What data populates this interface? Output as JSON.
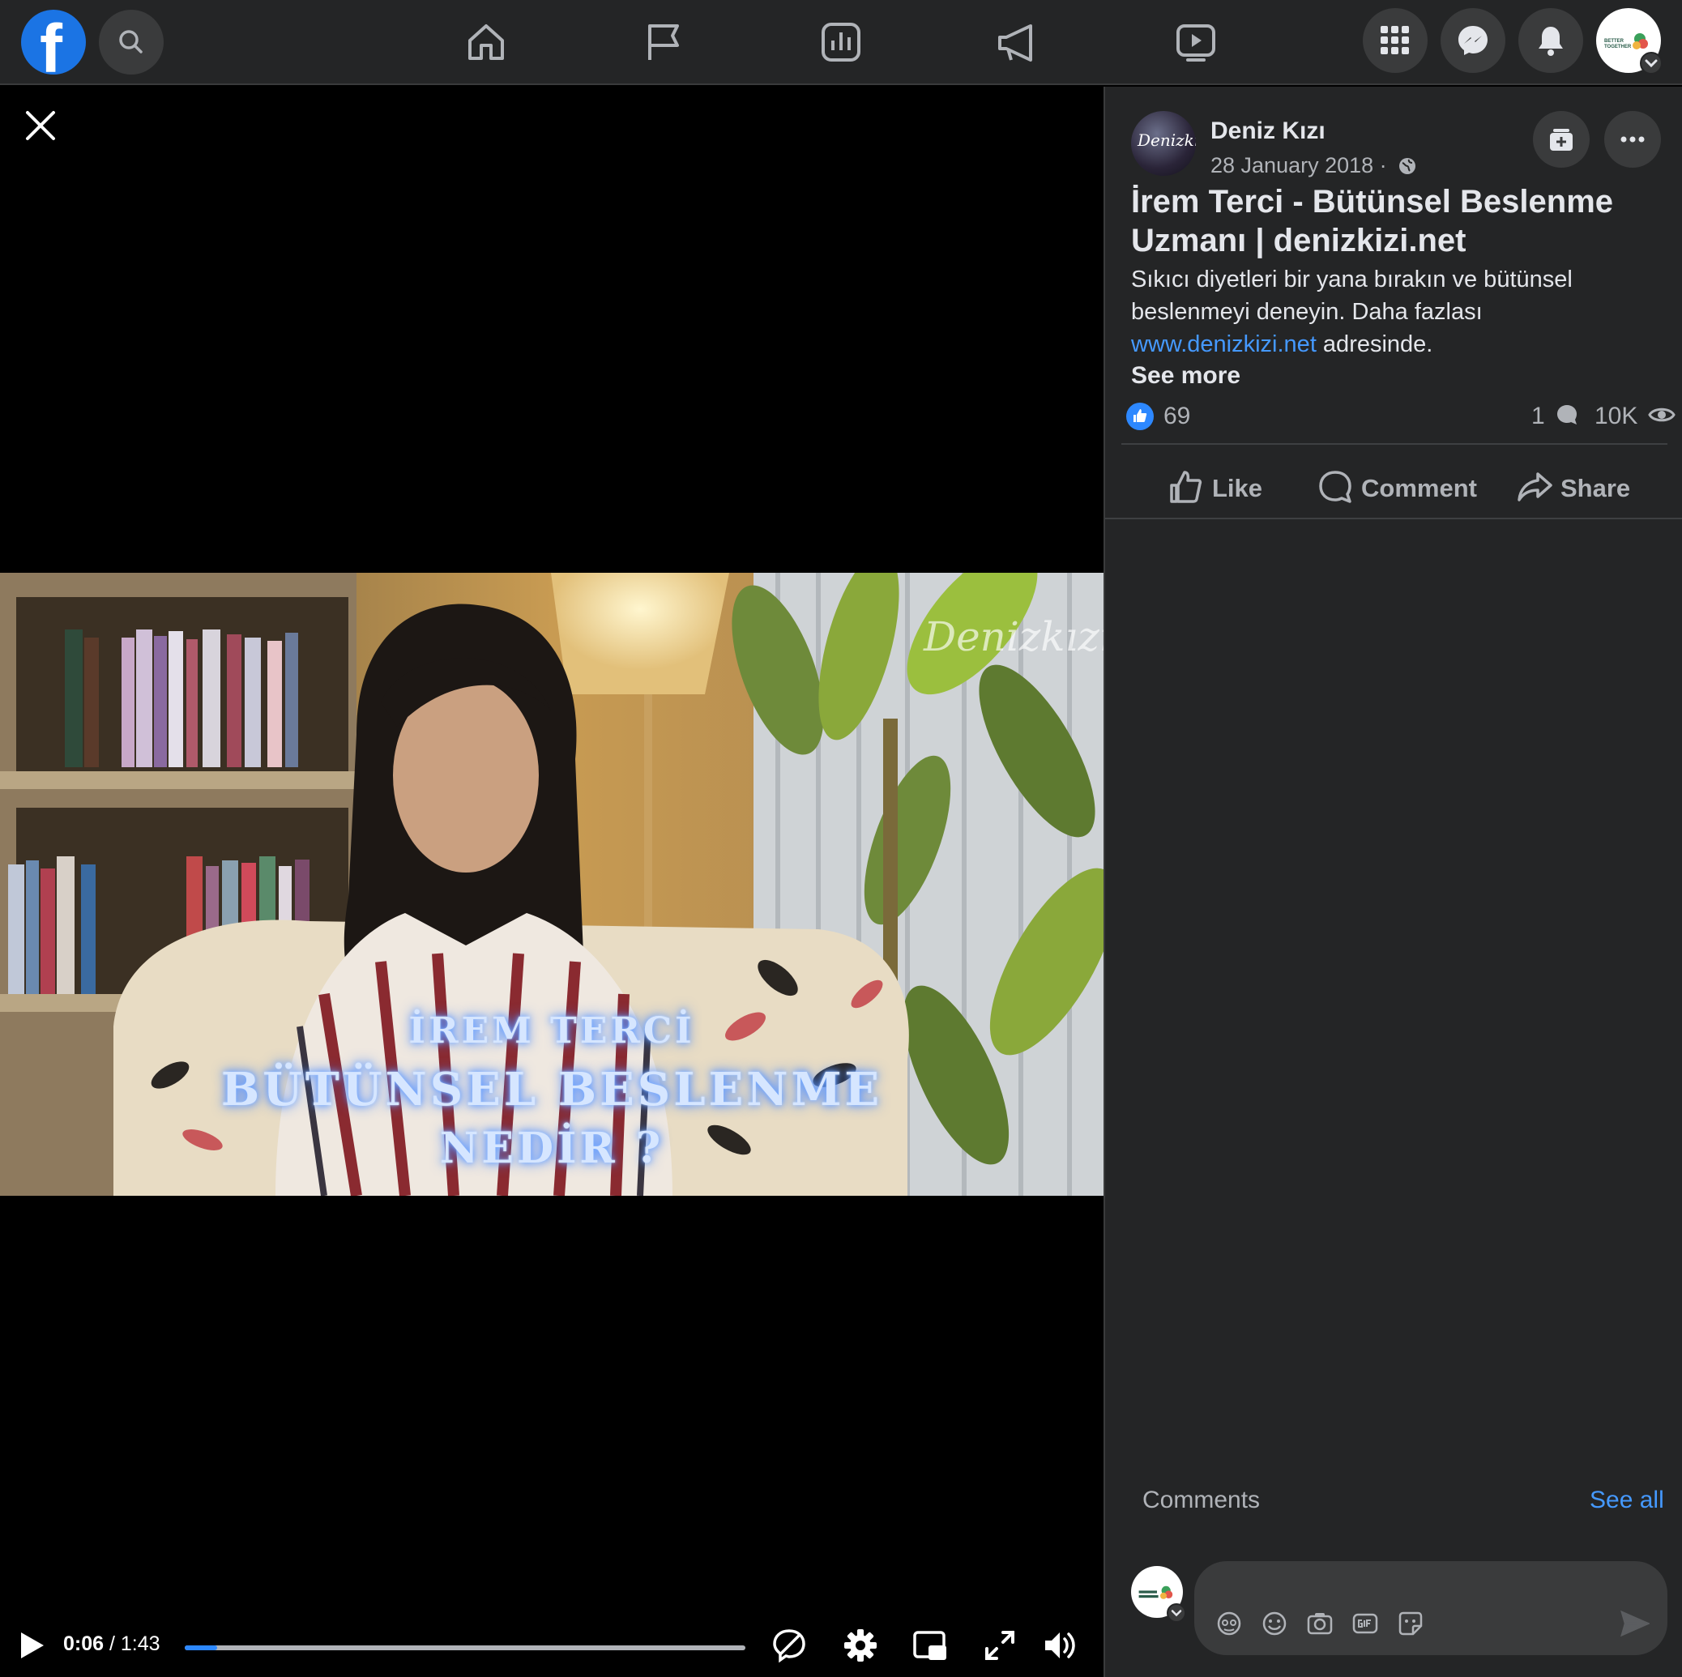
{
  "nav": {
    "logo_letter": "f",
    "icons": [
      "search-icon",
      "home-icon",
      "flag-icon",
      "insights-icon",
      "megaphone-icon",
      "watch-icon",
      "menu-grid-icon",
      "messenger-icon",
      "bell-icon"
    ],
    "profile_text": "BETTER TOGETHER"
  },
  "video": {
    "overlay_line1": "İREM TERCİ",
    "overlay_line2": "BÜTÜNSEL BESLENME",
    "overlay_line3": "NEDİR ?",
    "watermark": "Denizkızı",
    "current_time": "0:06",
    "time_separator": "/",
    "duration": "1:43",
    "progress_fraction": 0.058
  },
  "post": {
    "page_avatar_text": "Denizkızı",
    "page_name": "Deniz Kızı",
    "date": "28 January 2018 ·",
    "title": "İrem Terci - Bütünsel Beslenme Uzmanı | denizkizi.net",
    "body_text": "Sıkıcı diyetleri bir yana bırakın ve bütünsel beslenmeyi deneyin. Daha fazlası ",
    "body_link": "www.denizkizi.net",
    "body_suffix": " adresinde.",
    "see_more": "See more",
    "like_count": "69",
    "comment_count": "1",
    "view_count": "10K",
    "actions": {
      "like": "Like",
      "comment": "Comment",
      "share": "Share"
    }
  },
  "comments": {
    "label": "Comments",
    "see_all": "See all",
    "input_placeholder": ""
  },
  "colors": {
    "accent": "#2d88ff",
    "panel_bg": "#242526",
    "button_bg": "#3a3b3c"
  }
}
